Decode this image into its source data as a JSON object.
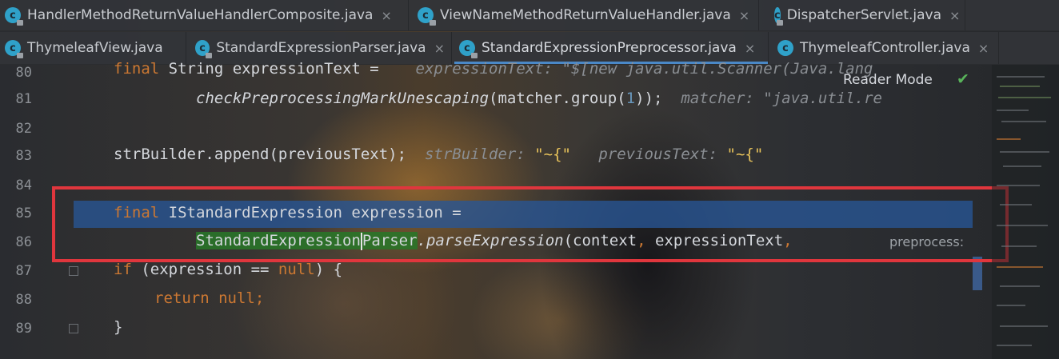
{
  "tabs_row1": [
    {
      "label": "HandlerMethodReturnValueHandlerComposite.java",
      "icon": "class-icon",
      "close": "×"
    },
    {
      "label": "ViewNameMethodReturnValueHandler.java",
      "icon": "class-icon",
      "close": "×"
    },
    {
      "label": "DispatcherServlet.java",
      "icon": "class-icon",
      "close": "×"
    }
  ],
  "tabs_row2": [
    {
      "label": "ThymeleafView.java",
      "icon": "class-icon",
      "close": "×"
    },
    {
      "label": "StandardExpressionParser.java",
      "icon": "class-icon",
      "close": "×"
    },
    {
      "label": "StandardExpressionPreprocessor.java",
      "icon": "class-icon",
      "close": "×",
      "active": true
    },
    {
      "label": "ThymeleafController.java",
      "icon": "class-icon",
      "close": "×"
    }
  ],
  "reader_mode": "Reader Mode",
  "line_numbers": [
    "80",
    "81",
    "82",
    "83",
    "84",
    "85",
    "86",
    "87",
    "88",
    "89"
  ],
  "code": {
    "l80_kw": "final",
    "l80_rest": " String expressionText =",
    "l80_hint": "expressionText: \"$[new java.util.Scanner(Java.lang",
    "l81_method": "checkPreprocessingMarkUnescaping",
    "l81_rest_a": "(matcher.group(",
    "l81_num": "1",
    "l81_rest_b": "));",
    "l81_hint": "matcher: \"java.util.re",
    "l83_code": "strBuilder.append(previousText);",
    "l83_hint_a": "strBuilder:",
    "l83_str_a": "\"~{\"",
    "l83_hint_b": "previousText:",
    "l83_str_b": "\"~{\"",
    "l85_kw": "final",
    "l85_rest": " IStandardExpression expression =",
    "l86_match_a": "StandardExpression",
    "l86_match_b": "Parser",
    "l86_method": ".parseExpression",
    "l86_rest_a": "(context",
    "l86_comma1": ",",
    "l86_rest_b": " expressionText",
    "l86_comma2": ",",
    "l86_hint": "preprocess:",
    "l87_kw": "if",
    "l87_rest_a": " (expression == ",
    "l87_null": "null",
    "l87_rest_b": ") {",
    "l88_kw": "return",
    "l88_null": "null",
    "l88_semi": ";",
    "l89": "}"
  },
  "colors": {
    "keyword": "#cc7832",
    "number": "#6897bb",
    "string": "#e7c25a",
    "selection": "#285696",
    "highlight_box": "#e0363d",
    "active_tab_underline": "#4a88c7"
  }
}
